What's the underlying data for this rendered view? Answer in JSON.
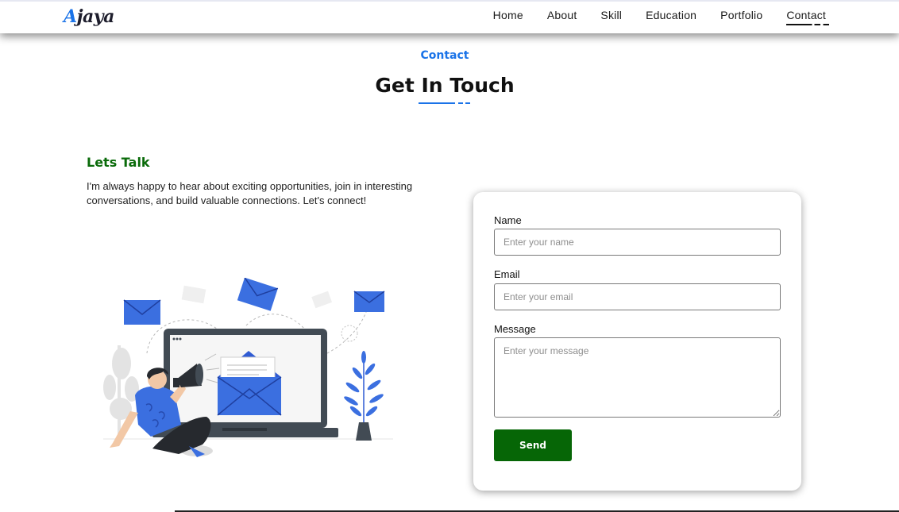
{
  "nav": {
    "logo": {
      "first": "A",
      "rest": "jaya"
    },
    "links": [
      "Home",
      "About",
      "Skill",
      "Education",
      "Portfolio",
      "Contact"
    ],
    "active": "Contact"
  },
  "section": {
    "tag": "Contact",
    "title": "Get In Touch"
  },
  "intro": {
    "heading": "Lets Talk",
    "text": "I'm always happy to hear about exciting opportunities, join in interesting conversations, and build valuable connections. Let's connect!"
  },
  "form": {
    "name_label": "Name",
    "name_placeholder": "Enter your name",
    "email_label": "Email",
    "email_placeholder": "Enter your email",
    "message_label": "Message",
    "message_placeholder": "Enter your message",
    "send_label": "Send"
  },
  "colors": {
    "accent": "#1a73e8",
    "heading_green": "#0a6b0a",
    "button_green": "#066606"
  },
  "icons": [
    "megaphone-icon",
    "envelope-icon",
    "laptop-icon",
    "plant-icon"
  ]
}
